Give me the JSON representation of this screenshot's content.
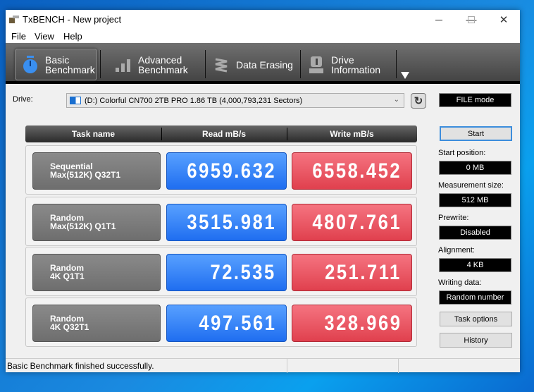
{
  "window": {
    "title": "TxBENCH - New project"
  },
  "menu": [
    "File",
    "View",
    "Help"
  ],
  "tabs": [
    {
      "line1": "Basic",
      "line2": "Benchmark"
    },
    {
      "line1": "Advanced",
      "line2": "Benchmark"
    },
    {
      "line1": "Data Erasing"
    },
    {
      "line1": "Drive",
      "line2": "Information"
    }
  ],
  "drive": {
    "label": "Drive:",
    "value": "(D:) Colorful CN700 2TB PRO  1.86 TB (4,000,793,231 Sectors)"
  },
  "table": {
    "headers": [
      "Task name",
      "Read mB/s",
      "Write mB/s"
    ],
    "rows": [
      {
        "task1": "Sequential",
        "task2": "Max(512K) Q32T1",
        "read": "6959.632",
        "write": "6558.452"
      },
      {
        "task1": "Random",
        "task2": "Max(512K) Q1T1",
        "read": "3515.981",
        "write": "4807.761"
      },
      {
        "task1": "Random",
        "task2": "4K Q1T1",
        "read": "72.535",
        "write": "251.711"
      },
      {
        "task1": "Random",
        "task2": "4K Q32T1",
        "read": "497.561",
        "write": "328.969"
      }
    ]
  },
  "side": {
    "mode": "FILE mode",
    "start": "Start",
    "start_position_label": "Start position:",
    "start_position": "0 MB",
    "measurement_size_label": "Measurement size:",
    "measurement_size": "512 MB",
    "prewrite_label": "Prewrite:",
    "prewrite": "Disabled",
    "alignment_label": "Alignment:",
    "alignment": "4 KB",
    "writing_data_label": "Writing data:",
    "writing_data": "Random number",
    "task_options": "Task options",
    "history": "History"
  },
  "status": "Basic Benchmark finished successfully."
}
